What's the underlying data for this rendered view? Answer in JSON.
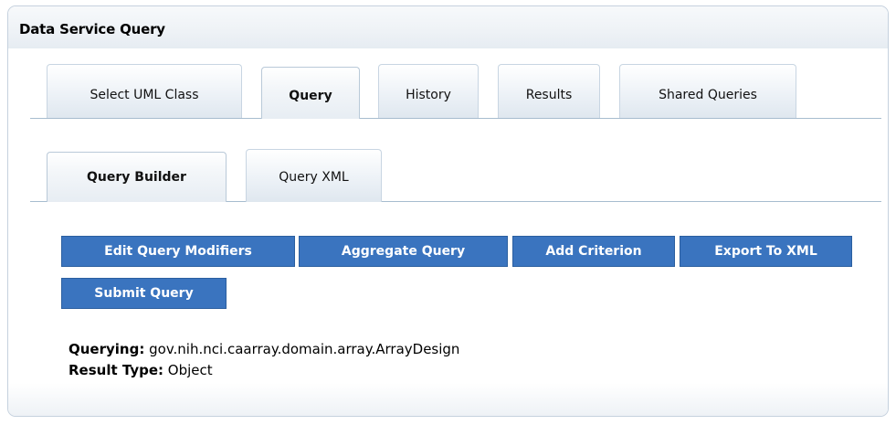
{
  "panel": {
    "title": "Data Service Query"
  },
  "main_tabs": [
    {
      "label": "Select UML Class",
      "active": false
    },
    {
      "label": "Query",
      "active": true
    },
    {
      "label": "History",
      "active": false
    },
    {
      "label": "Results",
      "active": false
    },
    {
      "label": "Shared Queries",
      "active": false
    }
  ],
  "sub_tabs": [
    {
      "label": "Query Builder",
      "active": true
    },
    {
      "label": "Query XML",
      "active": false
    }
  ],
  "buttons": {
    "edit_modifiers": "Edit Query Modifiers",
    "aggregate": "Aggregate Query",
    "add_criterion": "Add Criterion",
    "export_xml": "Export To XML",
    "submit": "Submit Query"
  },
  "info": {
    "querying_label": "Querying:",
    "querying_value": "gov.nih.nci.caarray.domain.array.ArrayDesign",
    "result_type_label": "Result Type:",
    "result_type_value": "Object"
  },
  "colors": {
    "button_bg": "#3a74bf",
    "tab_line": "#a7bccf"
  }
}
